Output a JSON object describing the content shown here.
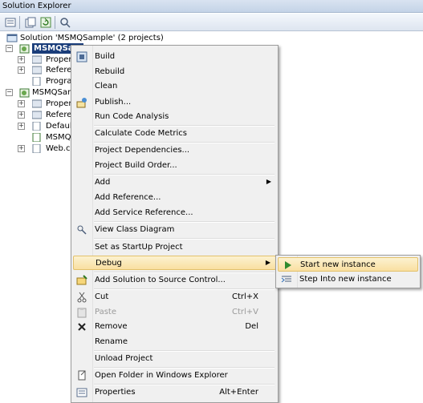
{
  "window": {
    "title": "Solution Explorer"
  },
  "toolbar": {
    "buttons": [
      "properties-icon",
      "show-all-files-icon",
      "refresh-icon",
      "class-view-icon"
    ]
  },
  "tree": {
    "solution": "Solution 'MSMQSample' (2 projects)",
    "project1": "MSMQSam",
    "p1_items": [
      "Proper",
      "Refere",
      "Prograr"
    ],
    "project2": "MSMQSamp",
    "p2_items": [
      "Proper",
      "Refere",
      "Default",
      "MSMQM",
      "Web.co"
    ]
  },
  "context_menu": {
    "items": [
      {
        "label": "Build",
        "icon": "build-icon"
      },
      {
        "label": "Rebuild"
      },
      {
        "label": "Clean"
      },
      {
        "label": "Publish...",
        "icon": "publish-icon"
      },
      {
        "label": "Run Code Analysis"
      },
      {
        "label": "Calculate Code Metrics"
      },
      {
        "label": "Project Dependencies..."
      },
      {
        "label": "Project Build Order..."
      },
      {
        "label": "Add"
      },
      {
        "label": "Add Reference..."
      },
      {
        "label": "Add Service Reference..."
      },
      {
        "label": "View Class Diagram",
        "icon": "class-diagram-icon"
      },
      {
        "label": "Set as StartUp Project"
      },
      {
        "label": "Debug"
      },
      {
        "label": "Add Solution to Source Control...",
        "icon": "source-control-icon"
      },
      {
        "label": "Cut",
        "shortcut": "Ctrl+X",
        "icon": "cut-icon"
      },
      {
        "label": "Paste",
        "shortcut": "Ctrl+V",
        "icon": "paste-icon"
      },
      {
        "label": "Remove",
        "shortcut": "Del",
        "icon": "remove-icon"
      },
      {
        "label": "Rename"
      },
      {
        "label": "Unload Project"
      },
      {
        "label": "Open Folder in Windows Explorer",
        "icon": "open-folder-icon"
      },
      {
        "label": "Properties",
        "shortcut": "Alt+Enter",
        "icon": "properties-icon"
      }
    ]
  },
  "debug_submenu": {
    "items": [
      {
        "label": "Start new instance",
        "icon": "play-icon"
      },
      {
        "label": "Step Into new instance",
        "icon": "step-into-icon"
      }
    ]
  },
  "colors": {
    "selection": "#1a3d7a",
    "highlight": "#f9dfa0",
    "highlight_border": "#e3c16b"
  }
}
